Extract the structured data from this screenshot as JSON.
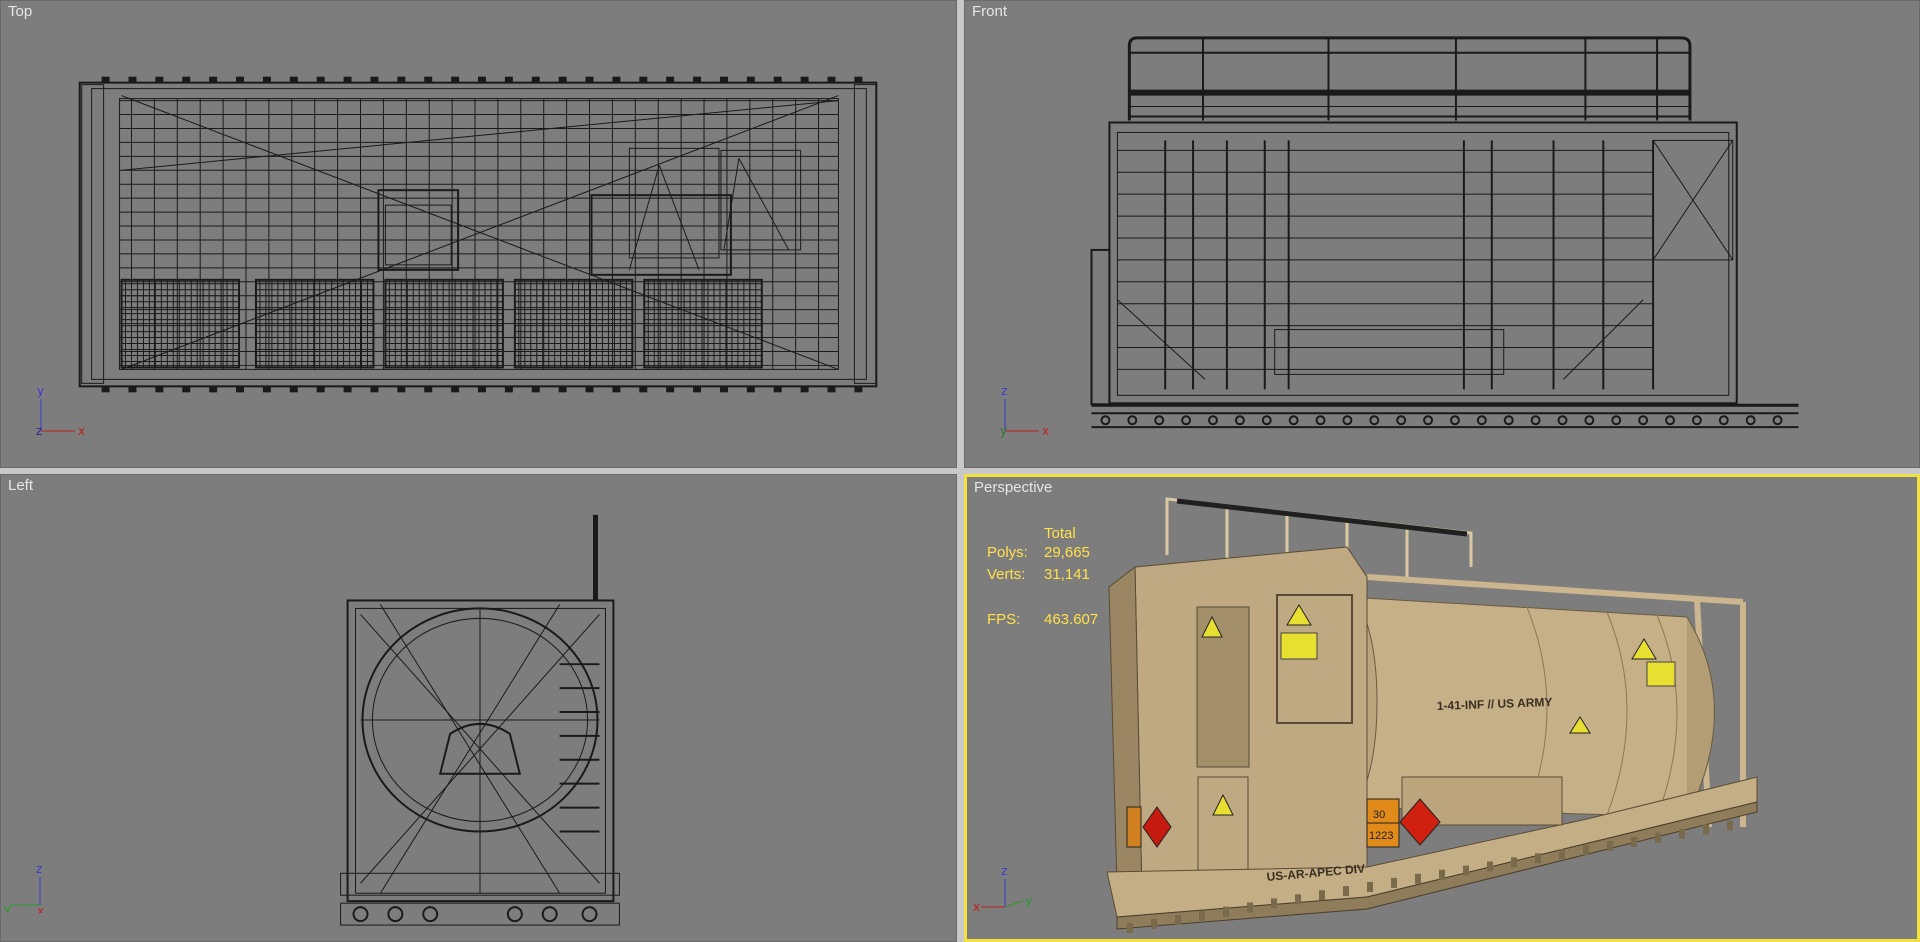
{
  "viewports": {
    "top": {
      "label": "Top",
      "axes": {
        "up": "y",
        "right": "x",
        "out": "z"
      }
    },
    "front": {
      "label": "Front",
      "axes": {
        "up": "z",
        "right": "x",
        "out": "y"
      }
    },
    "left": {
      "label": "Left",
      "axes": {
        "up": "z",
        "right": "x",
        "out": "y"
      }
    },
    "perspective": {
      "label": "Perspective",
      "active": true,
      "axes": {
        "up": "z",
        "right": "y",
        "out": "x"
      },
      "stats": {
        "header": "Total",
        "polys_label": "Polys:",
        "polys": "29,665",
        "verts_label": "Verts:",
        "verts": "31,141",
        "fps_label": "FPS:",
        "fps": "463.607"
      },
      "model_text": {
        "tank_marking": "1-41-INF // US ARMY",
        "base_marking": "US-AR-APEC DIV",
        "hazard_code_top": "30",
        "hazard_code_bottom": "1223"
      }
    }
  },
  "colors": {
    "viewport_bg": "#7d7d7d",
    "active_border": "#f0e040",
    "stats_text": "#ffe14a",
    "wire": "#1a1a1a",
    "tan": "#c9b58f"
  }
}
